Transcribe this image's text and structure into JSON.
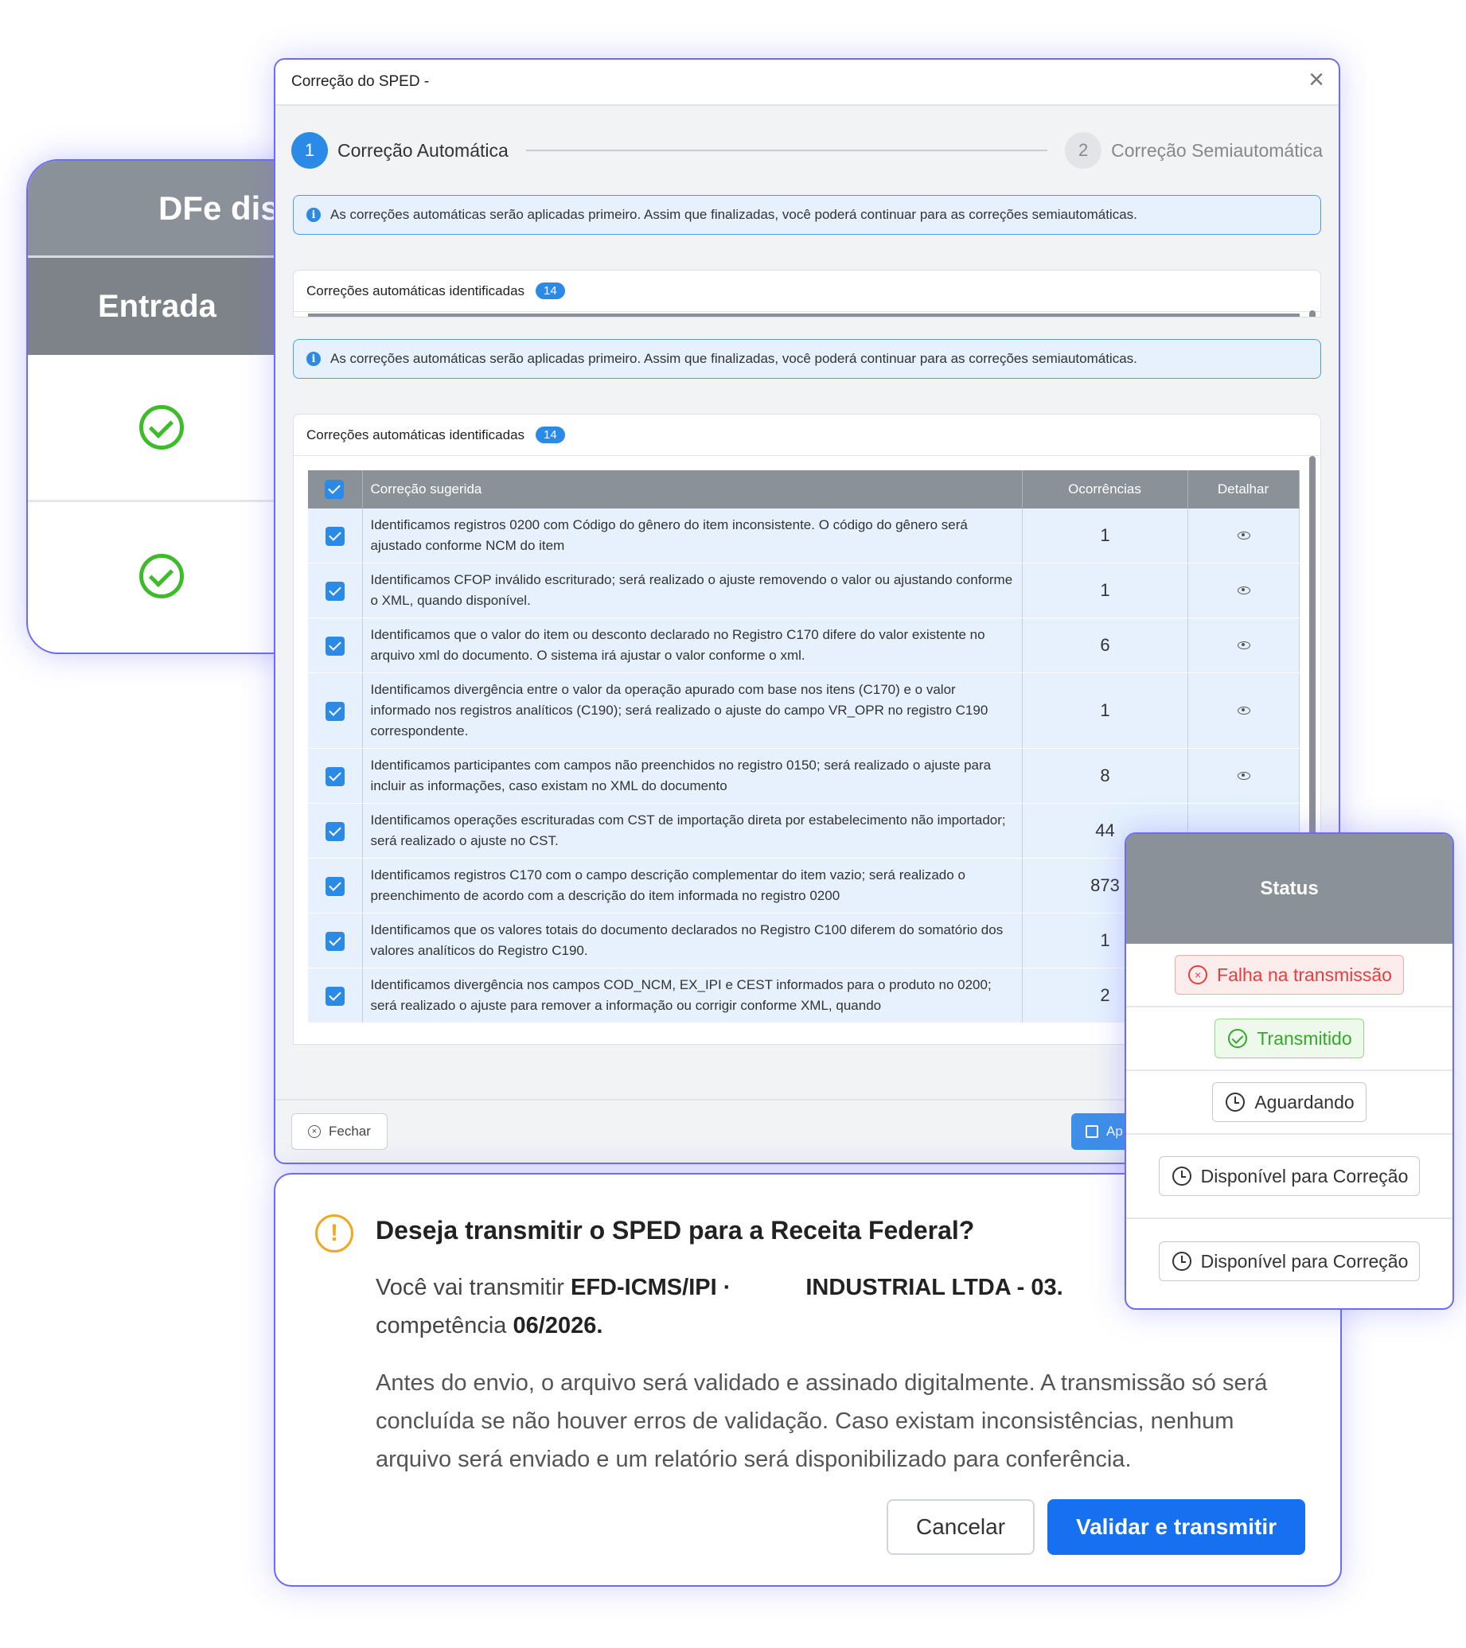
{
  "dfe_card": {
    "title": "DFe dis",
    "column": "Entrada",
    "rows": [
      {
        "icon": "check-circle-icon"
      },
      {
        "icon": "check-circle-icon"
      }
    ]
  },
  "modal": {
    "title": "Correção do SPED -",
    "close": "×",
    "steps": [
      {
        "number": "1",
        "label": "Correção Automática",
        "active": true
      },
      {
        "number": "2",
        "label": "Correção Semiautomática",
        "active": false
      }
    ],
    "info_text": "As correções automáticas serão aplicadas primeiro. Assim que finalizadas, você poderá continuar para as correções semiautomáticas.",
    "panel_title": "Correções automáticas identificadas",
    "panel_count": "14",
    "table": {
      "headers": [
        "Correção sugerida",
        "Ocorrências",
        "Detalhar"
      ],
      "rows": [
        {
          "description": "Identificamos registros 0200 com Código do gênero do item inconsistente. O código do gênero será ajustado conforme NCM do item",
          "occurrences": "1",
          "has_eye": true
        },
        {
          "description": "Identificamos CFOP inválido escriturado; será realizado o ajuste removendo o valor ou ajustando conforme o XML, quando disponível.",
          "occurrences": "1",
          "has_eye": true
        },
        {
          "description": "Identificamos que o valor do item ou desconto declarado no Registro C170 difere do valor existente no arquivo xml do documento. O sistema irá ajustar o valor conforme o xml.",
          "occurrences": "6",
          "has_eye": true
        },
        {
          "description": "Identificamos divergência entre o valor da operação apurado com base nos itens (C170) e o valor informado nos registros analíticos (C190); será realizado o ajuste do campo VR_OPR no registro C190 correspondente.",
          "occurrences": "1",
          "has_eye": true
        },
        {
          "description": "Identificamos participantes com campos não preenchidos no registro 0150; será realizado o ajuste para incluir as informações, caso existam no XML do documento",
          "occurrences": "8",
          "has_eye": true
        },
        {
          "description": "Identificamos operações escrituradas com CST de importação direta por estabelecimento não importador; será realizado o ajuste no CST.",
          "occurrences": "44",
          "has_eye": false
        },
        {
          "description": "Identificamos registros C170 com o campo descrição complementar do item vazio; será realizado o preenchimento de acordo com a descrição do item informada no registro 0200",
          "occurrences": "873",
          "has_eye": false
        },
        {
          "description": "Identificamos que os valores totais do documento declarados no Registro C100 diferem do somatório dos valores analíticos do Registro C190.",
          "occurrences": "1",
          "has_eye": false
        },
        {
          "description": "Identificamos divergência nos campos COD_NCM, EX_IPI e CEST informados para o produto no 0200; será realizado o ajuste para remover a informação ou corrigir conforme XML, quando",
          "occurrences": "2",
          "has_eye": false
        }
      ]
    },
    "footer": {
      "close_label": "Fechar",
      "apply_label": "Ap"
    }
  },
  "status": {
    "header": "Status",
    "items": [
      {
        "label": "Falha na transmissão",
        "kind": "fail"
      },
      {
        "label": "Transmitido",
        "kind": "ok"
      },
      {
        "label": "Aguardando",
        "kind": "neutral"
      },
      {
        "label": "Disponível para Correção",
        "kind": "neutral"
      },
      {
        "label": "Disponível para Correção",
        "kind": "neutral"
      }
    ]
  },
  "confirm": {
    "icon": "!",
    "title": "Deseja transmitir o SPED para a Receita Federal?",
    "line1_prefix": "Você vai transmitir ",
    "line1_file": "EFD-ICMS/IPI ·",
    "line1_company": "INDUSTRIAL LTDA - 03.",
    "line2_prefix": "competência ",
    "line2_period": "06/2026.",
    "body": "Antes do envio, o arquivo será validado e assinado digitalmente. A transmissão só será concluída se não houver erros de validação. Caso existam inconsistências, nenhum arquivo será enviado e um relatório será disponibilizado para conferência.",
    "cancel_label": "Cancelar",
    "validate_label": "Validar e transmitir"
  },
  "colors": {
    "accent": "#2b8ae6",
    "primary_button": "#1670f0",
    "header_gray": "#8b9198",
    "frame": "#6b6bff",
    "success": "#34a829",
    "error": "#e53e3e",
    "warning": "#f0a820"
  }
}
